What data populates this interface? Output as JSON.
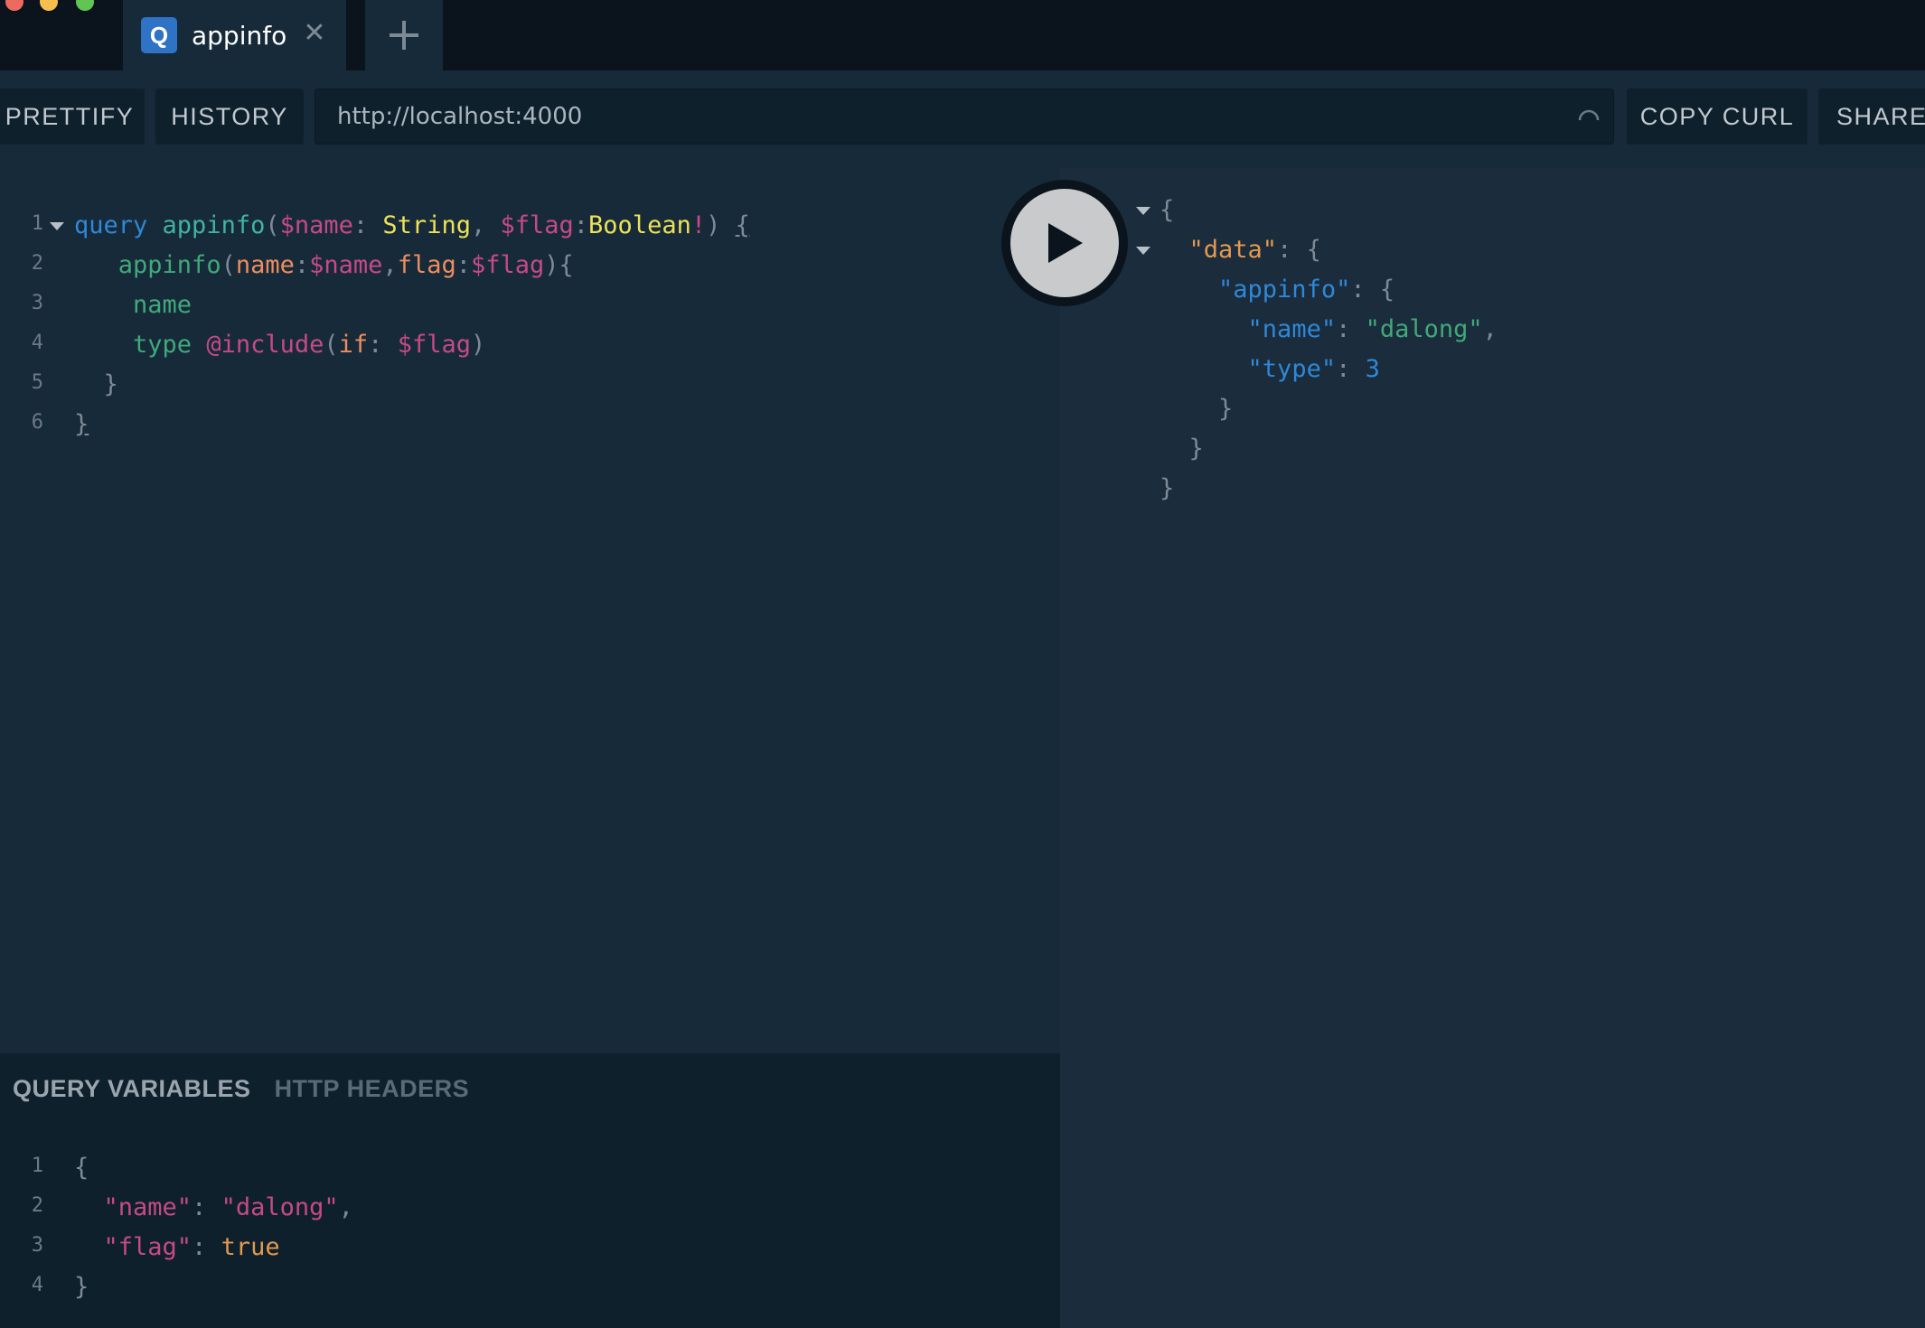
{
  "tabs": {
    "active": {
      "badge": "Q",
      "title": "appinfo",
      "close": "✕"
    }
  },
  "toolbar": {
    "prettify_label": "PRETTIFY",
    "history_label": "HISTORY",
    "endpoint_url": "http://localhost:4000",
    "copy_curl_label": "COPY CURL",
    "share_label": "SHARE"
  },
  "editor": {
    "line_numbers": [
      "1",
      "2",
      "3",
      "4",
      "5",
      "6"
    ]
  },
  "variables": {
    "tabs": [
      "QUERY VARIABLES",
      "HTTP HEADERS"
    ],
    "line_numbers": [
      "1",
      "2",
      "3",
      "4"
    ]
  },
  "colors": {
    "keyword": "#2f88d8",
    "variable": "#c64a85",
    "type": "#ece256",
    "field": "#40a97a",
    "argument": "#ed8d5f",
    "json_data_key": "#e3994f",
    "json_string": "#40a97a",
    "json_number": "#2f88d8",
    "boolean": "#e3994f",
    "background": "#172a3a",
    "panel_dark": "#0f202d"
  },
  "icons": {
    "tab_badge": "graphql-q-icon",
    "close": "close-icon",
    "add": "plus-icon",
    "spinner": "loading-spinner-icon",
    "run": "play-icon",
    "fold": "chevron-down-icon"
  }
}
